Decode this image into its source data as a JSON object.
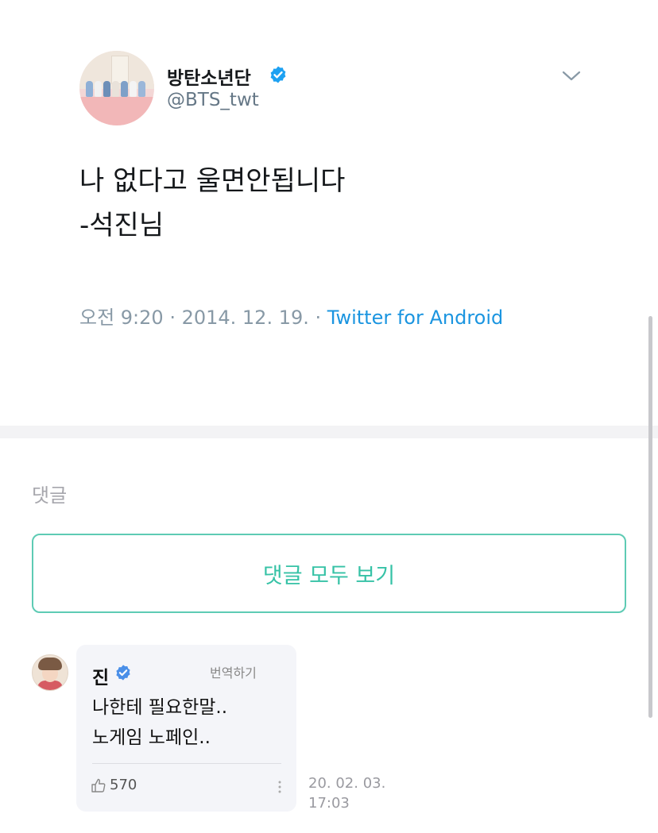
{
  "tweet": {
    "display_name": "방탄소년단",
    "handle": "@BTS_twt",
    "text_lines": [
      "나 없다고 울면안됩니다",
      "-석진님"
    ],
    "time": "오전 9:20",
    "date": "2014. 12. 19.",
    "source": "Twitter for Android",
    "icons": [
      "verified-icon",
      "chevron-down-icon"
    ]
  },
  "comments_section": {
    "label": "댓글",
    "view_all_label": "댓글 모두 보기"
  },
  "comment": {
    "author": "진",
    "translate_label": "번역하기",
    "text_lines": [
      "나한테 필요한말..",
      "노게임 노페인.."
    ],
    "likes": "570",
    "date": "20. 02. 03.",
    "time": "17:03",
    "icons": [
      "verified-icon",
      "thumbs-up-icon",
      "more-vertical-icon"
    ]
  },
  "colors": {
    "accent_teal": "#36c2a6",
    "link_blue": "#1b95e0",
    "verified_blue": "#1da1f2",
    "muted_gray": "#8899a6"
  }
}
